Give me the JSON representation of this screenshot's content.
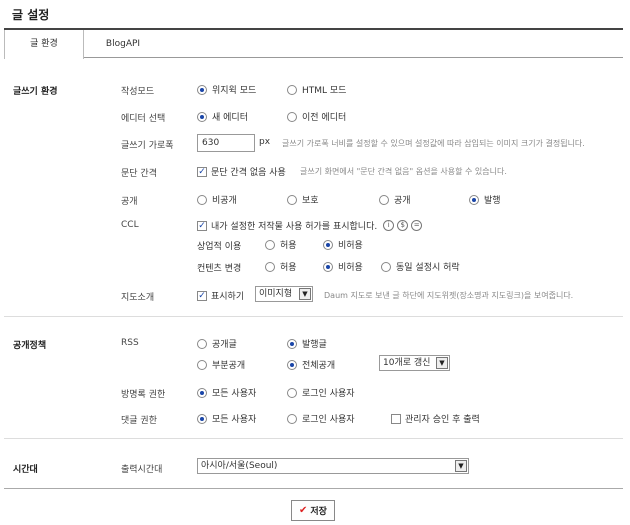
{
  "page": {
    "title": "글 설정"
  },
  "tabs": [
    {
      "label": "글 환경"
    },
    {
      "label": "BlogAPI"
    }
  ],
  "writing": {
    "section_title": "글쓰기 환경",
    "mode": {
      "label": "작성모드",
      "options": [
        "위지윅 모드",
        "HTML 모드"
      ]
    },
    "editor": {
      "label": "에디터 선택",
      "options": [
        "새 에디터",
        "이전 에디터"
      ]
    },
    "width": {
      "label": "글쓰기 가로폭",
      "value": "630",
      "unit": "px",
      "desc": "글쓰기 가로폭 너비를 설정할 수 있으며 설정값에 따라 삽입되는 이미지 크기가 결정됩니다."
    },
    "paragraph": {
      "label": "문단 간격",
      "checkbox": "문단 간격 없음 사용",
      "desc": "글쓰기 화면에서 \"문단 간격 없음\" 옵션을 사용할 수 있습니다."
    },
    "visibility": {
      "label": "공개",
      "options": [
        "비공개",
        "보호",
        "공개",
        "발행"
      ]
    },
    "ccl": {
      "label": "CCL",
      "checkbox": "내가 설정한 저작물 사용 허가를 표시합니다.",
      "commercial": {
        "label": "상업적 이용",
        "options": [
          "허용",
          "비허용"
        ]
      },
      "modify": {
        "label": "컨텐츠 변경",
        "options": [
          "허용",
          "비허용",
          "동일 설정시 허락"
        ]
      }
    },
    "map": {
      "label": "지도소개",
      "checkbox": "표시하기",
      "select": "이미지형",
      "desc": "Daum 지도로 보낸 글 하단에 지도위젯(장소명과 지도링크)을 보여줍니다."
    }
  },
  "policy": {
    "section_title": "공개정책",
    "rss": {
      "label": "RSS",
      "row1": [
        "공개글",
        "발행글"
      ],
      "row2": [
        "부분공개",
        "전체공개"
      ],
      "select": "10개로 갱신"
    },
    "guestbook": {
      "label": "방명록 권한",
      "options": [
        "모든 사용자",
        "로그인 사용자"
      ]
    },
    "comment": {
      "label": "댓글 권한",
      "options": [
        "모든 사용자",
        "로그인 사용자"
      ],
      "checkbox": "관리자 승인 후 출력"
    }
  },
  "timezone": {
    "section_title": "시간대",
    "label": "출력시간대",
    "select": "아시아/서울(Seoul)"
  },
  "actions": {
    "save": "저장"
  },
  "colors": {
    "accent": "#1a46a8",
    "save_check": "#dd2222"
  }
}
